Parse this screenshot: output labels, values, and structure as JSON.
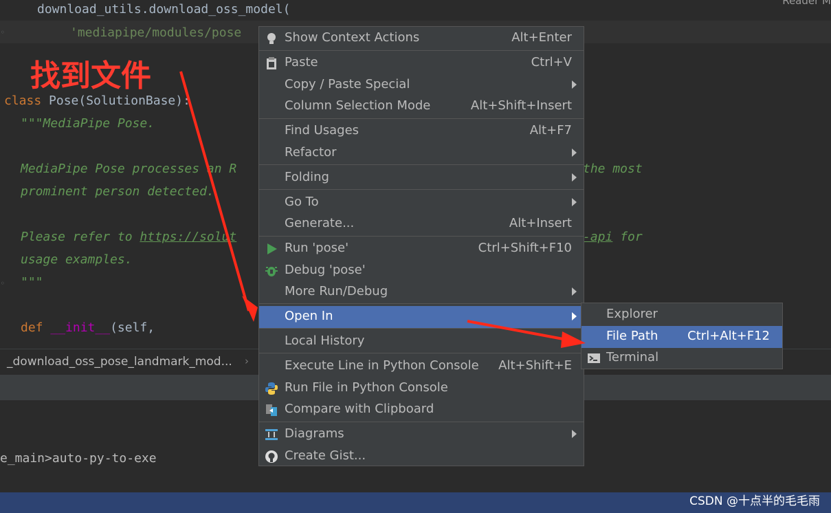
{
  "editor": {
    "reader_mode": "Reader M",
    "lines": {
      "l1": "download_utils.download_oss_model(",
      "l2": "'mediapipe/modules/pose",
      "l4_kw": "class",
      "l4_rest": " Pose(SolutionBase):",
      "l5": "\"\"\"MediaPipe Pose.",
      "l7a": "MediaPipe Pose processes an R",
      "l7b": "the most",
      "l8": "prominent person detected.",
      "l10_pre": "Please refer to ",
      "l10_link_a": "https://solut",
      "l10_link_b": "-api",
      "l10_post": " for",
      "l11": "usage examples.",
      "l12": "\"\"\"",
      "l14_kw": "def",
      "l14_fn": "__init__",
      "l14_rest": "(self,"
    }
  },
  "annotation": {
    "text": "找到文件",
    "color": "#ff3b2f"
  },
  "breadcrumb": {
    "text": "_download_oss_pose_landmark_mod..."
  },
  "terminal": {
    "line": "e_main>auto-py-to-exe"
  },
  "watermark": "CSDN @十点半的毛毛雨",
  "context_menu": {
    "items": [
      {
        "label": "Show Context Actions",
        "shortcut": "Alt+Enter",
        "icon": "lightbulb-icon"
      },
      {
        "label": "Paste",
        "shortcut": "Ctrl+V",
        "icon": "clipboard-icon"
      },
      {
        "label": "Copy / Paste Special",
        "shortcut": "",
        "submenu": true
      },
      {
        "label": "Column Selection Mode",
        "shortcut": "Alt+Shift+Insert"
      },
      {
        "label": "Find Usages",
        "shortcut": "Alt+F7"
      },
      {
        "label": "Refactor",
        "shortcut": "",
        "submenu": true
      },
      {
        "label": "Folding",
        "shortcut": "",
        "submenu": true
      },
      {
        "label": "Go To",
        "shortcut": "",
        "submenu": true
      },
      {
        "label": "Generate...",
        "shortcut": "Alt+Insert"
      },
      {
        "label": "Run 'pose'",
        "shortcut": "Ctrl+Shift+F10",
        "icon": "run-icon"
      },
      {
        "label": "Debug 'pose'",
        "shortcut": "",
        "icon": "debug-icon"
      },
      {
        "label": "More Run/Debug",
        "shortcut": "",
        "submenu": true
      },
      {
        "label": "Open In",
        "shortcut": "",
        "submenu": true,
        "selected": true
      },
      {
        "label": "Local History",
        "shortcut": "",
        "submenu": true
      },
      {
        "label": "Execute Line in Python Console",
        "shortcut": "Alt+Shift+E"
      },
      {
        "label": "Run File in Python Console",
        "shortcut": "",
        "icon": "python-icon"
      },
      {
        "label": "Compare with Clipboard",
        "shortcut": "",
        "icon": "compare-icon"
      },
      {
        "label": "Diagrams",
        "shortcut": "",
        "submenu": true,
        "icon": "diagram-icon"
      },
      {
        "label": "Create Gist...",
        "shortcut": "",
        "icon": "github-icon"
      }
    ]
  },
  "submenu": {
    "items": [
      {
        "label": "Explorer",
        "shortcut": ""
      },
      {
        "label": "File Path",
        "shortcut": "Ctrl+Alt+F12",
        "selected": true
      },
      {
        "label": "Terminal",
        "shortcut": "",
        "icon": "terminal-icon"
      }
    ]
  },
  "colors": {
    "selection": "#4b6eaf",
    "menu_bg": "#3c3f41",
    "editor_bg": "#2b2b2b",
    "status_bar": "#2d4372"
  }
}
